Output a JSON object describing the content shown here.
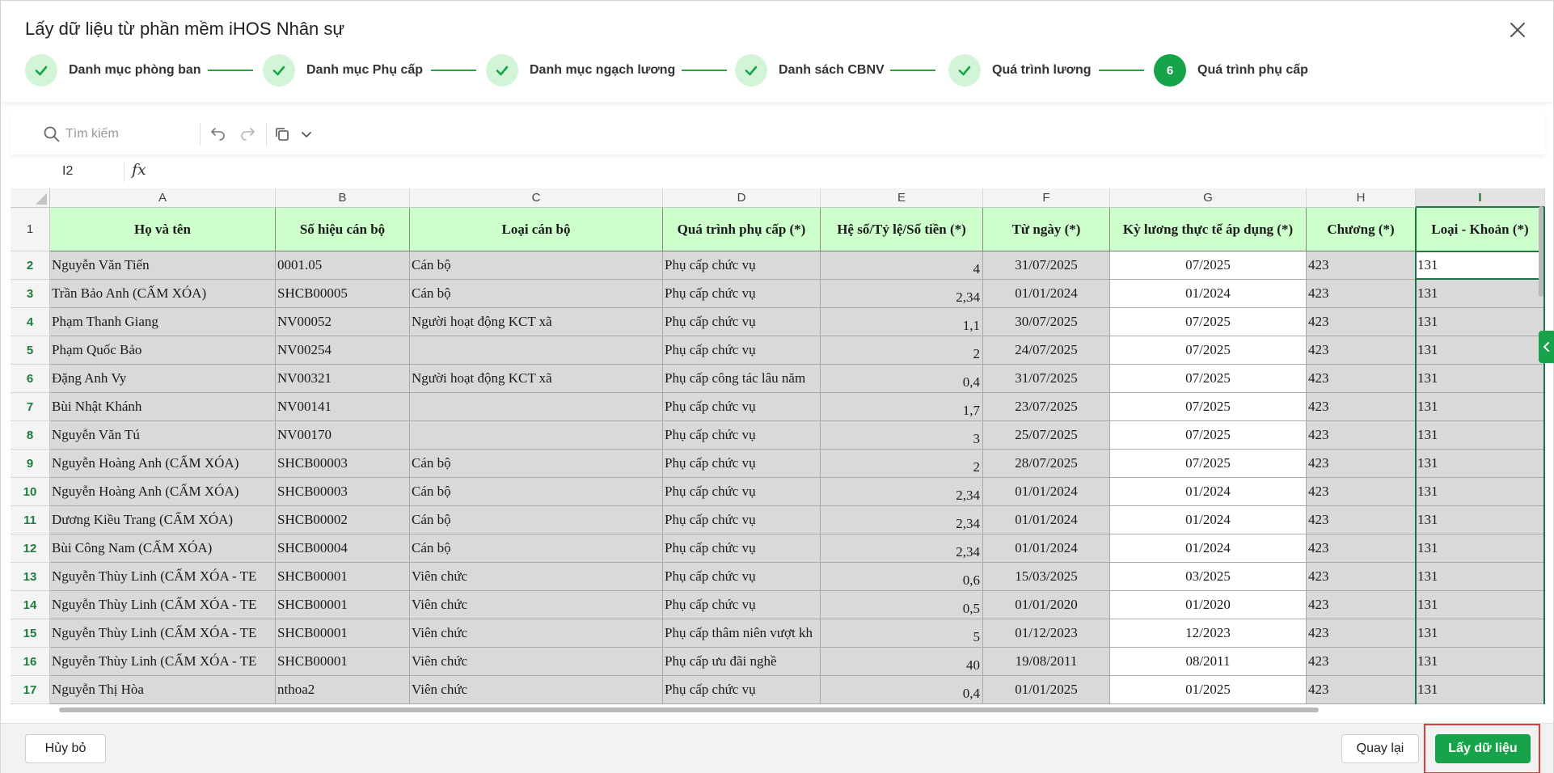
{
  "dialog": {
    "title": "Lấy dữ liệu từ phần mềm iHOS Nhân sự"
  },
  "stepper": {
    "steps": [
      {
        "label": "Danh mục phòng ban",
        "status": "done"
      },
      {
        "label": "Danh mục Phụ cấp",
        "status": "done"
      },
      {
        "label": "Danh mục ngạch lương",
        "status": "done"
      },
      {
        "label": "Danh sách CBNV",
        "status": "done"
      },
      {
        "label": "Quá trình lương",
        "status": "done"
      },
      {
        "label": "Quá trình phụ cấp",
        "status": "active",
        "number": "6"
      }
    ]
  },
  "toolbar": {
    "search_placeholder": "Tìm kiếm",
    "icons": [
      "search-icon",
      "undo-icon",
      "redo-icon",
      "copy-icon",
      "chevron-down-icon"
    ]
  },
  "formula_bar": {
    "cell_ref": "I2",
    "fx_label": "fx",
    "value": ""
  },
  "sheet": {
    "column_letters": [
      "A",
      "B",
      "C",
      "D",
      "E",
      "F",
      "G",
      "H",
      "I"
    ],
    "selected_column": "I",
    "headers": [
      "Họ và tên",
      "Số hiệu cán bộ",
      "Loại cán bộ",
      "Quá trình phụ cấp (*)",
      "Hệ số/Tỷ lệ/Số tiền (*)",
      "Từ ngày (*)",
      "Kỳ lương thực tế áp dụng (*)",
      "Chương (*)",
      "Loại - Khoản (*)"
    ],
    "header_row_number": "1",
    "rows": [
      {
        "n": "2",
        "cells": [
          "Nguyễn Văn Tiến",
          "0001.05",
          "Cán bộ",
          "Phụ cấp chức vụ",
          "4",
          "31/07/2025",
          "07/2025",
          "423",
          "131"
        ]
      },
      {
        "n": "3",
        "cells": [
          "Trần Bảo Anh (CẤM XÓA)",
          "SHCB00005",
          "Cán bộ",
          "Phụ cấp chức vụ",
          "2,34",
          "01/01/2024",
          "01/2024",
          "423",
          "131"
        ]
      },
      {
        "n": "4",
        "cells": [
          "Phạm Thanh Giang",
          "NV00052",
          "Người hoạt động KCT xã",
          "Phụ cấp chức vụ",
          "1,1",
          "30/07/2025",
          "07/2025",
          "423",
          "131"
        ]
      },
      {
        "n": "5",
        "cells": [
          "Phạm Quốc Bảo",
          "NV00254",
          "",
          "Phụ cấp chức vụ",
          "2",
          "24/07/2025",
          "07/2025",
          "423",
          "131"
        ]
      },
      {
        "n": "6",
        "cells": [
          "Đặng Anh Vy",
          "NV00321",
          "Người hoạt động KCT xã",
          "Phụ cấp công tác lâu năm",
          "0,4",
          "31/07/2025",
          "07/2025",
          "423",
          "131"
        ]
      },
      {
        "n": "7",
        "cells": [
          "Bùi Nhật Khánh",
          "NV00141",
          "",
          "Phụ cấp chức vụ",
          "1,7",
          "23/07/2025",
          "07/2025",
          "423",
          "131"
        ]
      },
      {
        "n": "8",
        "cells": [
          "Nguyễn Văn Tú",
          "NV00170",
          "",
          "Phụ cấp chức vụ",
          "3",
          "25/07/2025",
          "07/2025",
          "423",
          "131"
        ]
      },
      {
        "n": "9",
        "cells": [
          "Nguyễn Hoàng Anh (CẤM XÓA)",
          "SHCB00003",
          "Cán bộ",
          "Phụ cấp chức vụ",
          "2",
          "28/07/2025",
          "07/2025",
          "423",
          "131"
        ]
      },
      {
        "n": "10",
        "cells": [
          "Nguyễn Hoàng Anh (CẤM XÓA)",
          "SHCB00003",
          "Cán bộ",
          "Phụ cấp chức vụ",
          "2,34",
          "01/01/2024",
          "01/2024",
          "423",
          "131"
        ]
      },
      {
        "n": "11",
        "cells": [
          "Dương Kiều Trang (CẤM XÓA)",
          "SHCB00002",
          "Cán bộ",
          "Phụ cấp chức vụ",
          "2,34",
          "01/01/2024",
          "01/2024",
          "423",
          "131"
        ]
      },
      {
        "n": "12",
        "cells": [
          "Bùi Công Nam (CẤM XÓA)",
          "SHCB00004",
          "Cán bộ",
          "Phụ cấp chức vụ",
          "2,34",
          "01/01/2024",
          "01/2024",
          "423",
          "131"
        ]
      },
      {
        "n": "13",
        "cells": [
          "Nguyễn Thùy Linh (CẤM XÓA - TE",
          "SHCB00001",
          "Viên chức",
          "Phụ cấp chức vụ",
          "0,6",
          "15/03/2025",
          "03/2025",
          "423",
          "131"
        ]
      },
      {
        "n": "14",
        "cells": [
          "Nguyễn Thùy Linh (CẤM XÓA - TE",
          "SHCB00001",
          "Viên chức",
          "Phụ cấp chức vụ",
          "0,5",
          "01/01/2020",
          "01/2020",
          "423",
          "131"
        ]
      },
      {
        "n": "15",
        "cells": [
          "Nguyễn Thùy Linh (CẤM XÓA - TE",
          "SHCB00001",
          "Viên chức",
          "Phụ cấp thâm niên vượt kh",
          "5",
          "01/12/2023",
          "12/2023",
          "423",
          "131"
        ]
      },
      {
        "n": "16",
        "cells": [
          "Nguyễn Thùy Linh (CẤM XÓA - TE",
          "SHCB00001",
          "Viên chức",
          "Phụ cấp ưu đãi nghề",
          "40",
          "19/08/2011",
          "08/2011",
          "423",
          "131"
        ]
      },
      {
        "n": "17",
        "cells": [
          "Nguyễn Thị Hòa",
          "nthoa2",
          "Viên chức",
          "Phụ cấp chức vụ",
          "0,4",
          "01/01/2025",
          "01/2025",
          "423",
          "131"
        ]
      }
    ]
  },
  "footer": {
    "cancel_label": "Hủy bỏ",
    "back_label": "Quay lại",
    "get_data_label": "Lấy dữ liệu"
  },
  "colors": {
    "accent": "#17a34a",
    "step_done_bg": "#d3f5d7",
    "header_row_bg": "#ccffcc",
    "locked_cell_bg": "#d9d9d9",
    "selection": "#217346",
    "highlight_border": "#e23a3a"
  }
}
